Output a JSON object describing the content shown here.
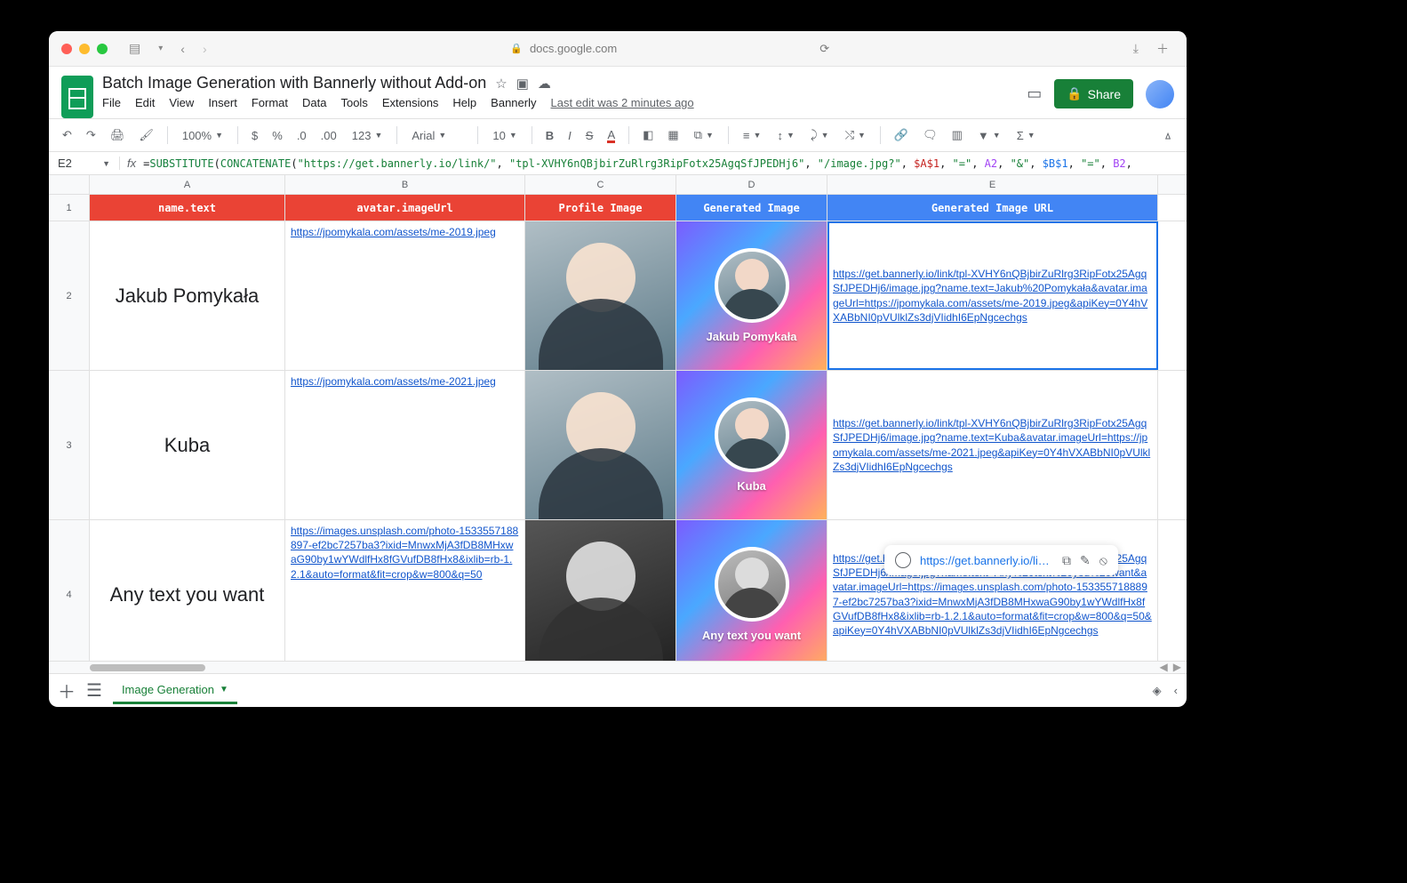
{
  "browser": {
    "domain": "docs.google.com"
  },
  "doc": {
    "title": "Batch Image Generation with Bannerly without Add-on",
    "last_edit": "Last edit was 2 minutes ago",
    "share_label": "Share"
  },
  "menus": [
    "File",
    "Edit",
    "View",
    "Insert",
    "Format",
    "Data",
    "Tools",
    "Extensions",
    "Help",
    "Bannerly"
  ],
  "toolbar": {
    "zoom": "100%",
    "currency": "$",
    "percent": "%",
    "dec_dec": ".0",
    "dec_inc": ".00",
    "numfmt": "123",
    "font": "Arial",
    "size": "10"
  },
  "formula_bar": {
    "cell_ref": "E2",
    "prefix": "=",
    "fn1": "SUBSTITUTE",
    "fn2": "CONCATENATE",
    "s1": "\"https://get.bannerly.io/link/\"",
    "s2": "\"tpl-XVHY6nQBjbirZuRlrg3RipFotx25AgqSfJPEDHj6\"",
    "s3": "\"/image.jpg?\"",
    "ra1": "$A$1",
    "eq1": "\"=\"",
    "rn1": "A2",
    "amp": "\"&\"",
    "rb1": "$B$1",
    "eq2": "\"=\"",
    "rn2": "B2"
  },
  "columns": [
    "A",
    "B",
    "C",
    "D",
    "E"
  ],
  "headers": {
    "A": "name.text",
    "B": "avatar.imageUrl",
    "C": "Profile Image",
    "D": "Generated Image",
    "E": "Generated Image URL"
  },
  "rows": [
    {
      "n": "2",
      "name": "Jakub Pomykała",
      "avatar_url": "https://jpomykala.com/assets/me-2019.jpeg",
      "gen_name": "Jakub Pomykała",
      "gen_url": "https://get.bannerly.io/link/tpl-XVHY6nQBjbirZuRlrg3RipFotx25AgqSfJPEDHj6/image.jpg?name.text=Jakub%20Pomykała&avatar.imageUrl=https://jpomykala.com/assets/me-2019.jpeg&apiKey=0Y4hVXABbNI0pVUlklZs3djVIidhI6EpNgcechgs"
    },
    {
      "n": "3",
      "name": "Kuba",
      "avatar_url": "https://jpomykala.com/assets/me-2021.jpeg",
      "gen_name": "Kuba",
      "gen_url": "https://get.bannerly.io/link/tpl-XVHY6nQBjbirZuRlrg3RipFotx25AgqSfJPEDHj6/image.jpg?name.text=Kuba&avatar.imageUrl=https://jpomykala.com/assets/me-2021.jpeg&apiKey=0Y4hVXABbNI0pVUlklZs3djVIidhI6EpNgcechgs"
    },
    {
      "n": "4",
      "name": "Any text you want",
      "avatar_url": "https://images.unsplash.com/photo-1533557188897-ef2bc7257ba3?ixid=MnwxMjA3fDB8MHxwaG90by1wYWdlfHx8fGVufDB8fHx8&ixlib=rb-1.2.1&auto=format&fit=crop&w=800&q=50",
      "gen_name": "Any text you want",
      "gen_url": "https://get.bannerly.io/link/tpl-XVHY6nQBjbirZuRlrg3RipFotx25AgqSfJPEDHj6/image.jpg?name.text=Any%20text%20you%20want&avatar.imageUrl=https://images.unsplash.com/photo-1533557188897-ef2bc7257ba3?ixid=MnwxMjA3fDB8MHxwaG90by1wYWdlfHx8fGVufDB8fHx8&ixlib=rb-1.2.1&auto=format&fit=crop&w=800&q=50&apiKey=0Y4hVXABbNI0pVUlklZs3djVIidhI6EpNgcechgs"
    }
  ],
  "link_popup": {
    "text": "https://get.bannerly.io/link..."
  },
  "sheet_tab": "Image Generation"
}
